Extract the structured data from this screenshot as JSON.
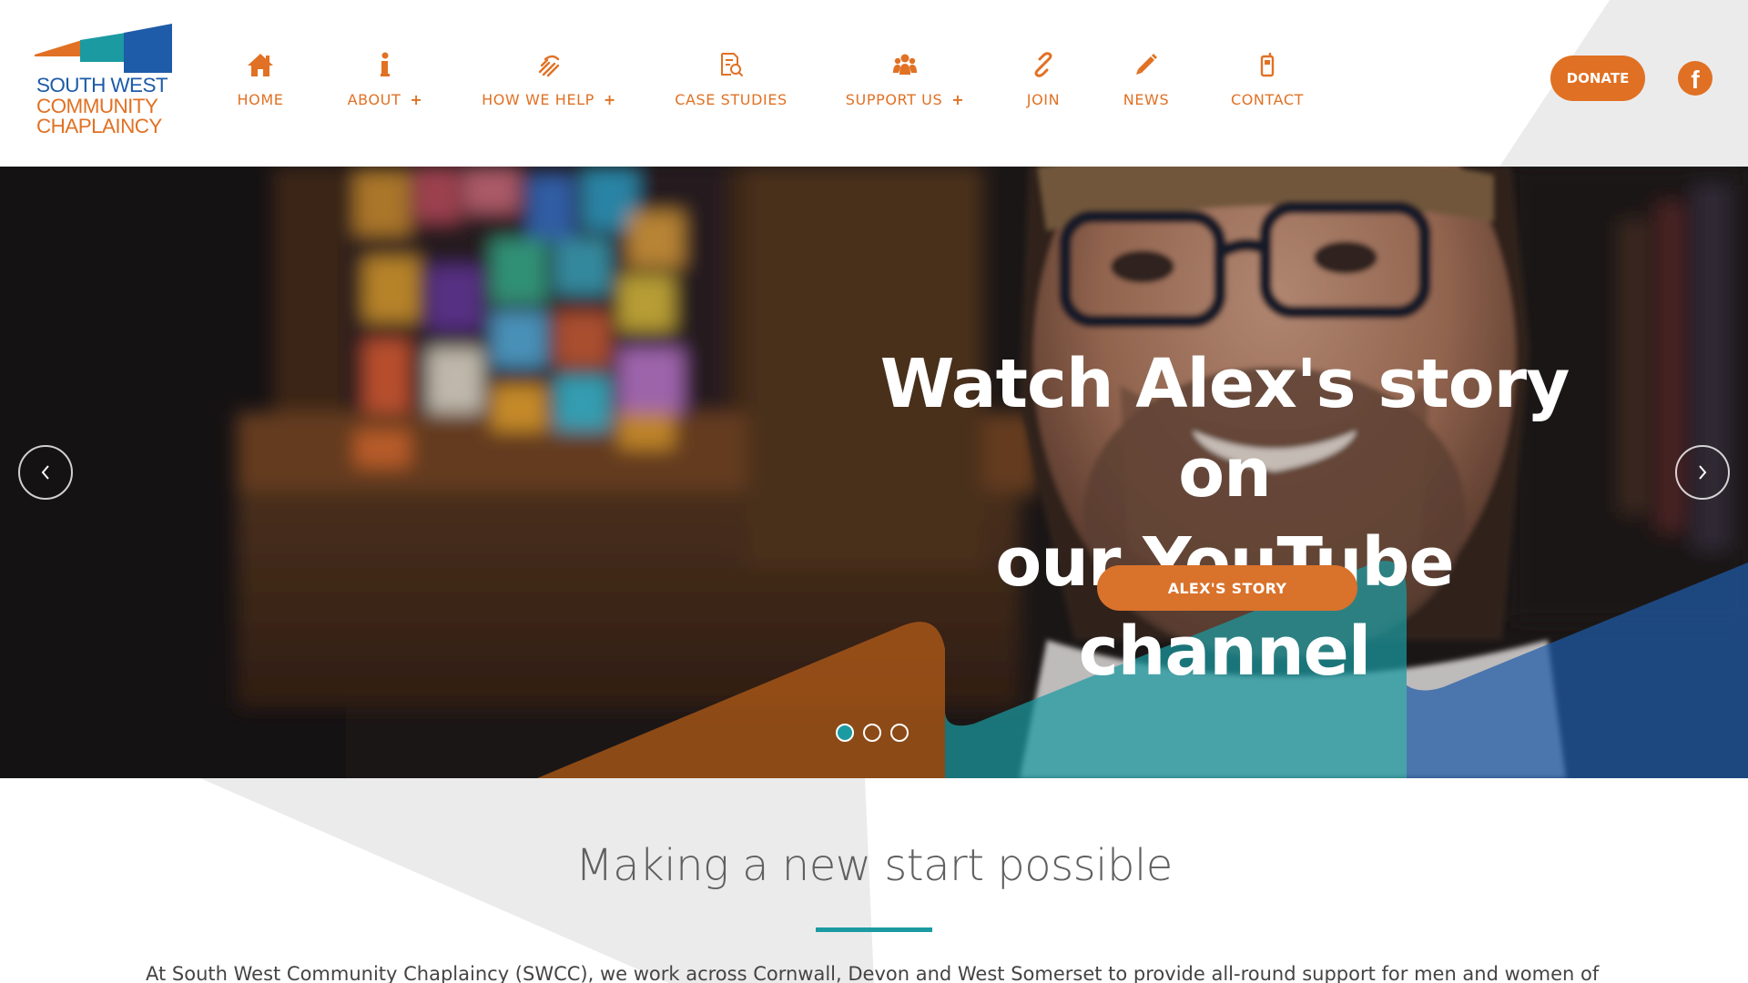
{
  "brand": {
    "logo_lines": [
      "SOUTH WEST",
      "COMMUNITY",
      "CHAPLAINCY"
    ],
    "colors": {
      "orange": "#e17124",
      "teal": "#1b9aa1",
      "blue": "#1e5ba8"
    }
  },
  "nav": {
    "items": [
      {
        "label": "HOME",
        "icon": "home-icon",
        "has_submenu": false
      },
      {
        "label": "ABOUT",
        "icon": "info-icon",
        "has_submenu": true
      },
      {
        "label": "HOW WE HELP",
        "icon": "helping-hand-icon",
        "has_submenu": true
      },
      {
        "label": "CASE STUDIES",
        "icon": "document-search-icon",
        "has_submenu": false
      },
      {
        "label": "SUPPORT US",
        "icon": "group-icon",
        "has_submenu": true
      },
      {
        "label": "JOIN",
        "icon": "link-icon",
        "has_submenu": false
      },
      {
        "label": "NEWS",
        "icon": "pencil-icon",
        "has_submenu": false
      },
      {
        "label": "CONTACT",
        "icon": "phone-icon",
        "has_submenu": false
      }
    ],
    "submenu_symbol": "+",
    "donate_label": "DONATE",
    "facebook_glyph": "f"
  },
  "hero": {
    "title_line1": "Watch Alex's story on",
    "title_line2": "our YouTube channel",
    "button_label": "ALEX'S STORY",
    "slide_count": 3,
    "active_slide": 1,
    "prev_icon": "chevron-left-icon",
    "next_icon": "chevron-right-icon"
  },
  "main": {
    "section_title": "Making a new start possible",
    "intro_text": "At South West Community Chaplaincy (SWCC), we work across Cornwall, Devon and West Somerset to provide all-round support for men and women of"
  }
}
